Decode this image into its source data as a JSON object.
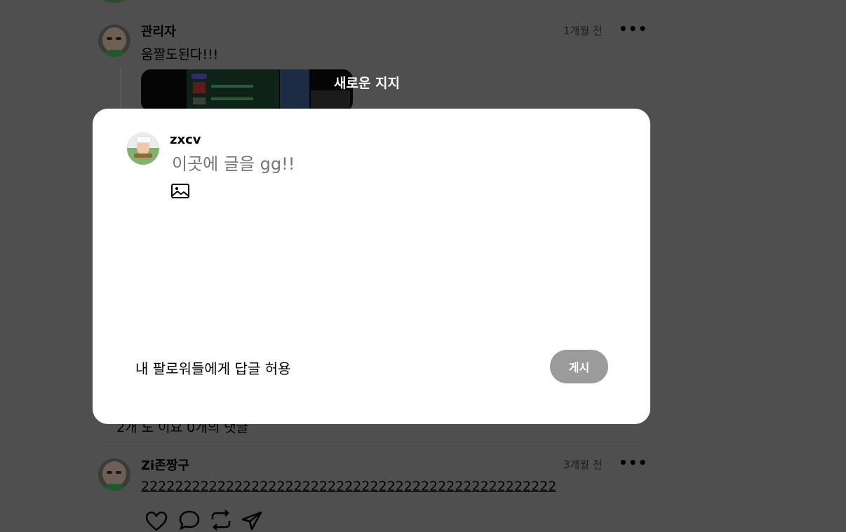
{
  "feed": {
    "post1": {
      "author": "관리자",
      "time": "1개월 전",
      "more": "•••",
      "text": "움짤도된다!!!",
      "stats_partial": "2개 도 이요 0개의 댓글"
    },
    "post2": {
      "author": "Zi존짱구",
      "time": "3개월 전",
      "more": "•••",
      "text": "2222222222222222222222222222222222222222222222222"
    },
    "action_icons": [
      "heart-icon",
      "comment-icon",
      "repost-icon",
      "send-icon"
    ]
  },
  "modal": {
    "title": "새로운 지지",
    "username": "zxcv",
    "placeholder": "이곳에 글을 gg!!",
    "image_icon": "image-icon",
    "allow_replies": "내 팔로워들에게 답글 허용",
    "post_button": "게시"
  },
  "colors": {
    "overlay": "#4f4f4f",
    "modal_bg": "#ffffff",
    "button_disabled": "#9b9b9b"
  }
}
